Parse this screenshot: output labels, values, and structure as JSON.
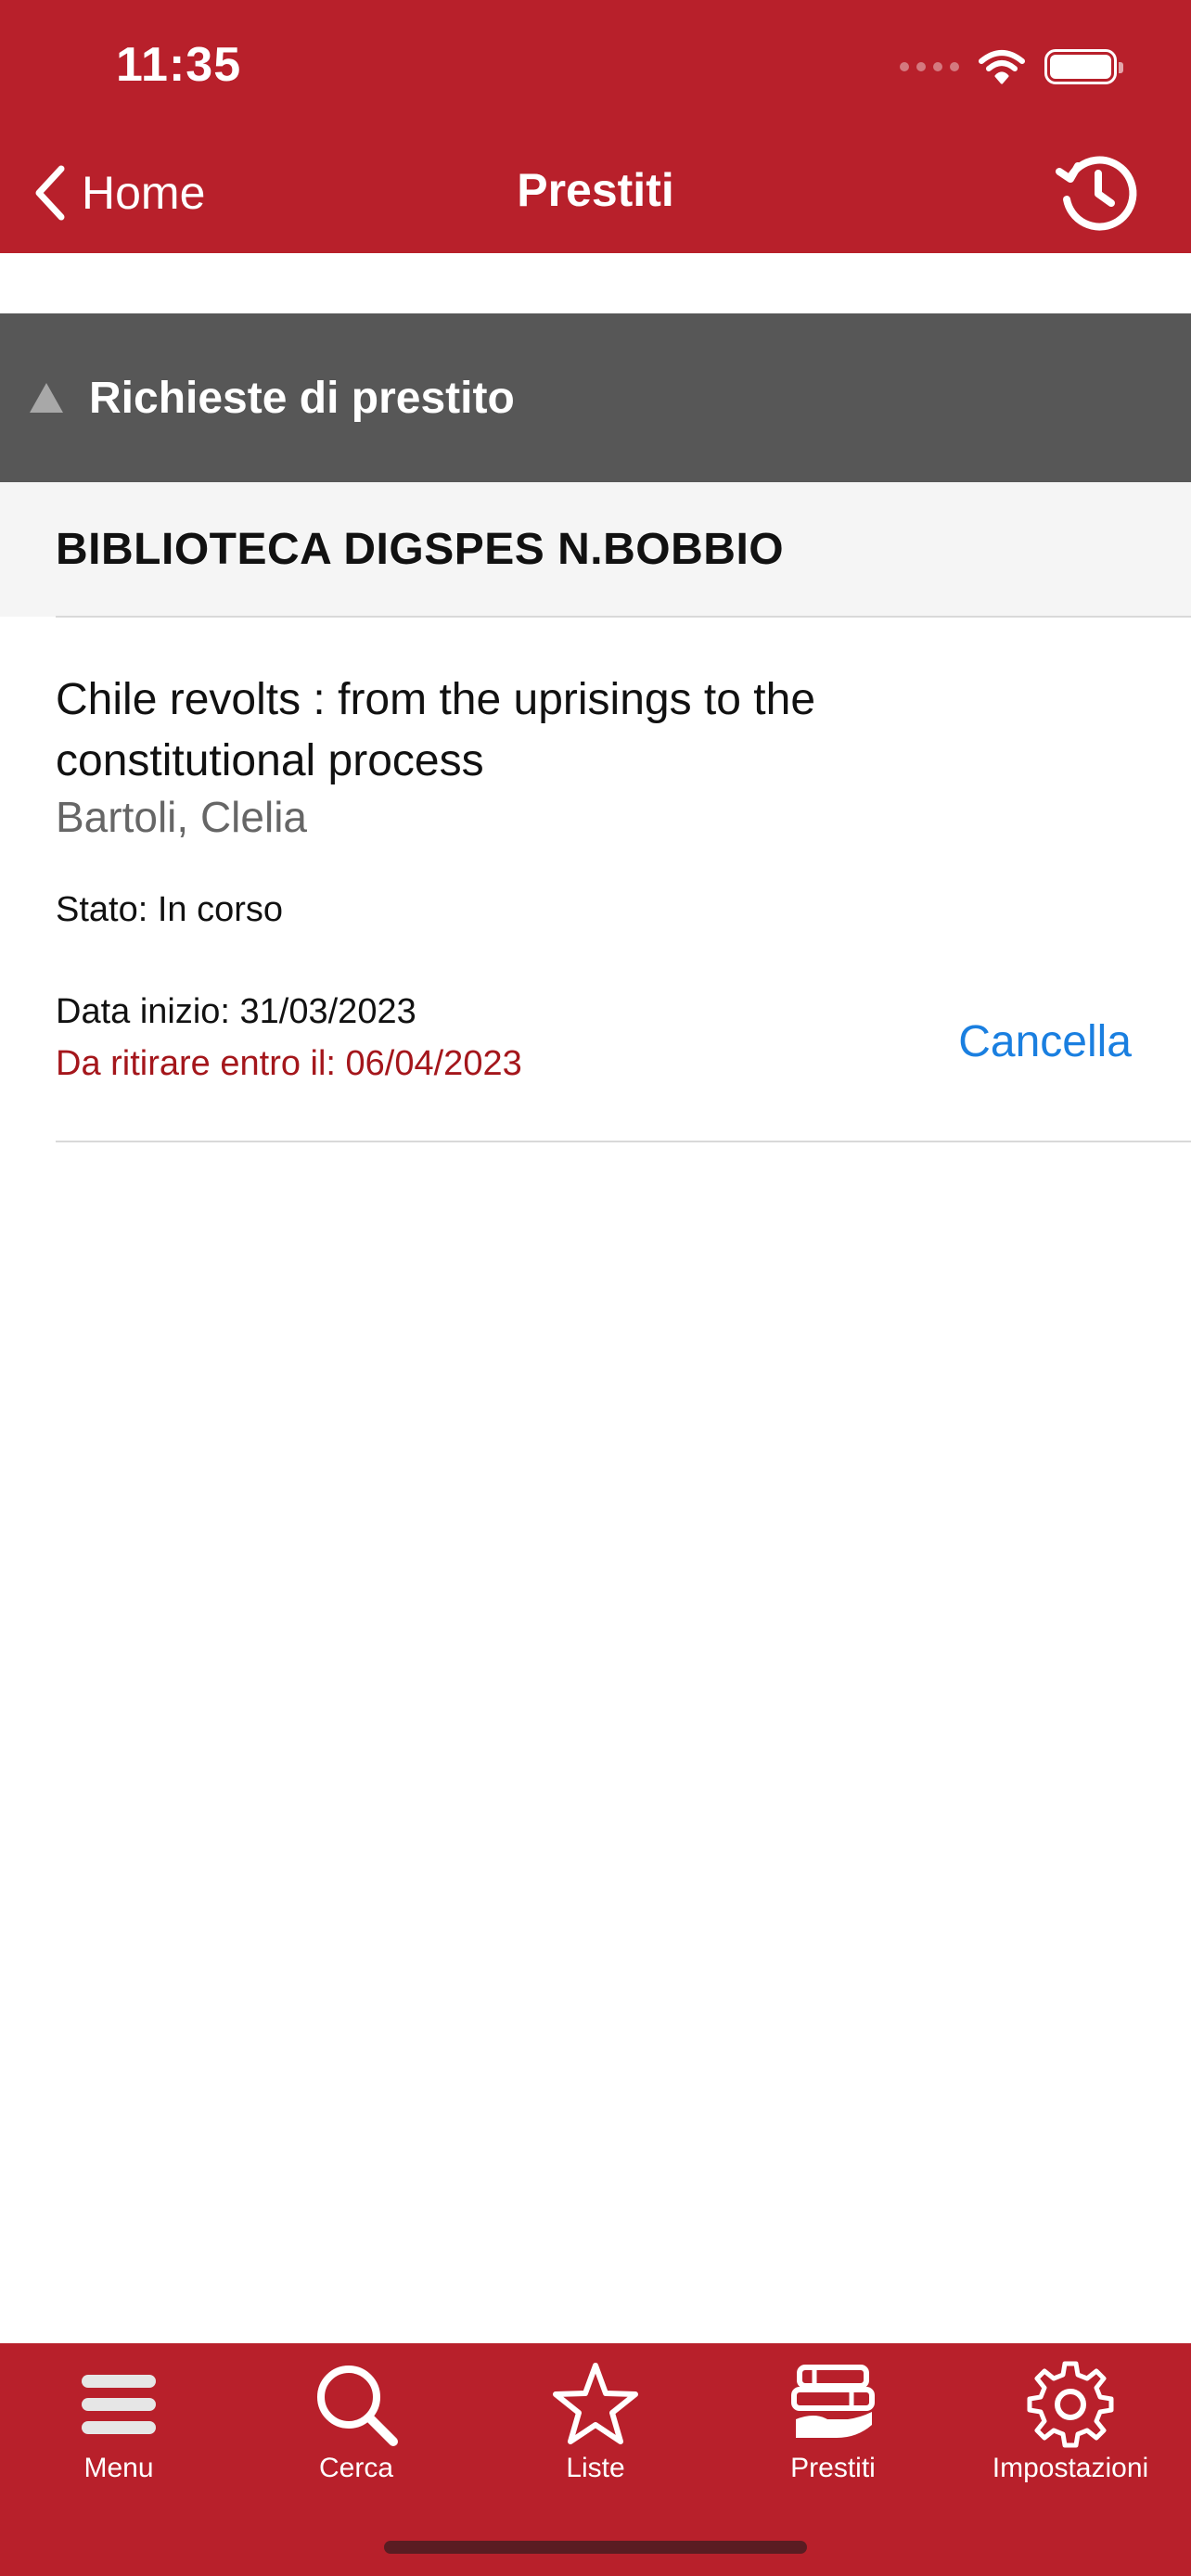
{
  "status_bar": {
    "time": "11:35"
  },
  "nav": {
    "back_label": "Home",
    "title": "Prestiti"
  },
  "section": {
    "label": "Richieste di prestito"
  },
  "library": {
    "name": "BIBLIOTECA DIGSPES N.BOBBIO"
  },
  "loan": {
    "title": "Chile revolts : from the uprisings to the constitutional process",
    "author": "Bartoli, Clelia",
    "status": "Stato: In corso",
    "start_date": "Data inizio: 31/03/2023",
    "due_date": "Da ritirare entro il: 06/04/2023",
    "cancel_label": "Cancella"
  },
  "tabbar": {
    "items": [
      {
        "label": "Menu",
        "icon": "menu-icon"
      },
      {
        "label": "Cerca",
        "icon": "search-icon"
      },
      {
        "label": "Liste",
        "icon": "star-icon"
      },
      {
        "label": "Prestiti",
        "icon": "books-icon"
      },
      {
        "label": "Impostazioni",
        "icon": "gear-icon"
      }
    ]
  },
  "colors": {
    "brand_red": "#b8202b",
    "section_gray": "#575757",
    "link_blue": "#1a7fe0",
    "due_red": "#a4161b"
  }
}
